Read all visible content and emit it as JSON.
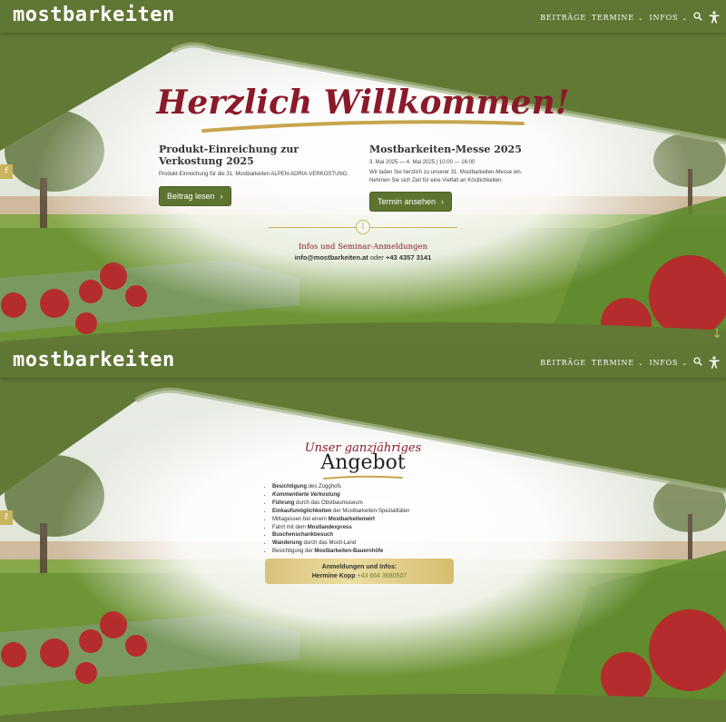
{
  "header": {
    "logo": "mostbarkeiten",
    "nav": [
      {
        "label": "Beiträge",
        "dropdown": false
      },
      {
        "label": "Termine",
        "dropdown": true
      },
      {
        "label": "Infos",
        "dropdown": true
      }
    ],
    "search_icon": "search-icon",
    "accessibility_icon": "accessibility-icon"
  },
  "hero": {
    "title": "Herzlich Willkommen!",
    "left": {
      "heading": "Produkt-Einreichung zur Verkostung 2025",
      "text": "Produkt-Einreichung für die 31. Mostbarkeiten ALPEN-ADRIA-VERKOSTUNG.",
      "button": "Beitrag lesen"
    },
    "right": {
      "heading": "Mostbarkeiten-Messe 2025",
      "date": "3. Mai 2025 — 4. Mai 2025 | 10:00 — 16:00",
      "text": "Wir laden Sie herzlich zu unserer 31. Mostbarkeiten-Messe ein. Nehmen Sie sich Zeit für eine Vielfalt an Köstlichkeiten.",
      "button": "Termin ansehen"
    },
    "info_title": "Infos und Seminar-Anmeldungen",
    "info_email": "info@mostbarkeiten.at",
    "info_or": "oder",
    "info_phone": "+43 4357 3141"
  },
  "offer": {
    "subtitle": "Unser ganzjähriges",
    "title": "Angebot",
    "items": [
      {
        "bold": "Besichtigung",
        "rest": " des Zogghofs"
      },
      {
        "italic": "Kommentierte Verkostung",
        "rest": ""
      },
      {
        "bold": "Führung",
        "rest": " durch das Obstbaumuseum"
      },
      {
        "bold": "Einkaufsmöglichkeiten",
        "rest": " der Mostbarkeiten-Spezialitäten"
      },
      {
        "pre": "Mittagessen bei einem ",
        "bold": "Mostbarkeitenwirt",
        "rest": ""
      },
      {
        "pre": "Fahrt mit dem ",
        "bold": "Mostlandexpress",
        "rest": ""
      },
      {
        "bold": "Buschenschankbesuch",
        "rest": ""
      },
      {
        "bold": "Wanderung",
        "rest": " durch das Mostl-Land"
      },
      {
        "pre": "Besichtigung der ",
        "bold": "Mostbarkeiten-Bauernhöfe",
        "rest": ""
      }
    ],
    "contact_title": "Anmeldungen und Infos:",
    "contact_name": "Hermine Kopp",
    "contact_phone": "+43 664 3680507"
  },
  "colors": {
    "brand_green": "#627935",
    "wine_red": "#8a1a2a",
    "gold": "#c9b45e"
  },
  "icons": {
    "sidebar_tab": "f",
    "scroll_down": "↓"
  }
}
